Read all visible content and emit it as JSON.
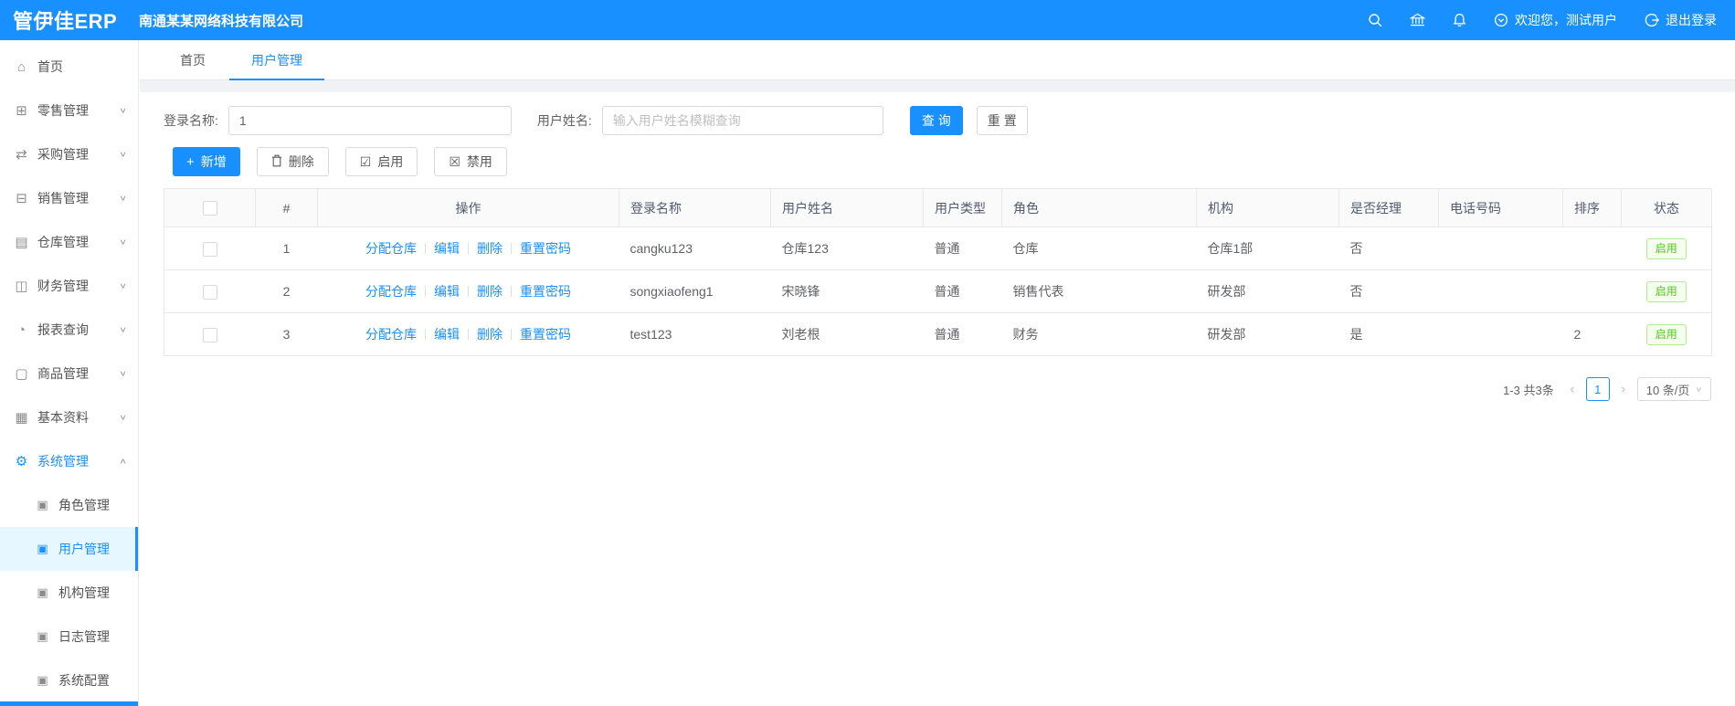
{
  "colors": {
    "primary": "#1890ff",
    "header_bg": "#1890ff",
    "success_text": "#52c41a",
    "success_border": "#b7eb8f",
    "success_bg": "#f6ffed",
    "selected_item_bg": "#e6f7ff"
  },
  "header": {
    "logo": "管伊佳ERP",
    "company": "南通某某网络科技有限公司",
    "welcome": "欢迎您，测试用户",
    "logout": "退出登录"
  },
  "sidebar": {
    "items": [
      {
        "label": "首页",
        "glyph": "⌂",
        "chevron": ""
      },
      {
        "label": "零售管理",
        "glyph": "⊞",
        "chevron": "∨"
      },
      {
        "label": "采购管理",
        "glyph": "⇄",
        "chevron": "∨"
      },
      {
        "label": "销售管理",
        "glyph": "⊟",
        "chevron": "∨"
      },
      {
        "label": "仓库管理",
        "glyph": "▤",
        "chevron": "∨"
      },
      {
        "label": "财务管理",
        "glyph": "◫",
        "chevron": "∨"
      },
      {
        "label": "报表查询",
        "glyph": "◔",
        "chevron": "∨"
      },
      {
        "label": "商品管理",
        "glyph": "▢",
        "chevron": "∨"
      },
      {
        "label": "基本资料",
        "glyph": "▦",
        "chevron": "∨"
      },
      {
        "label": "系统管理",
        "glyph": "⚙",
        "chevron": "∧"
      }
    ],
    "subitems": [
      {
        "label": "角色管理",
        "glyph": "▣"
      },
      {
        "label": "用户管理",
        "glyph": "▣"
      },
      {
        "label": "机构管理",
        "glyph": "▣"
      },
      {
        "label": "日志管理",
        "glyph": "▣"
      },
      {
        "label": "系统配置",
        "glyph": "▣"
      }
    ]
  },
  "tabs": [
    {
      "label": "首页"
    },
    {
      "label": "用户管理"
    }
  ],
  "filters": {
    "login_label": "登录名称:",
    "login_value": "1",
    "name_label": "用户姓名:",
    "name_placeholder": "输入用户姓名模糊查询",
    "search": "查 询",
    "reset": "重置"
  },
  "toolbar": {
    "add": "新增",
    "add_glyph": "+",
    "delete": "删除",
    "enable": "启用",
    "enable_glyph": "☑",
    "disable": "禁用",
    "disable_glyph": "☒"
  },
  "table": {
    "columns": [
      "#",
      "操作",
      "登录名称",
      "用户姓名",
      "用户类型",
      "角色",
      "机构",
      "是否经理",
      "电话号码",
      "排序",
      "状态"
    ],
    "action_links": [
      "分配仓库",
      "编辑",
      "删除",
      "重置密码"
    ],
    "rows": [
      {
        "index": "1",
        "login": "cangku123",
        "name": "仓库123",
        "type": "普通",
        "role": "仓库",
        "org": "仓库1部",
        "manager": "否",
        "phone": "",
        "sort": "",
        "status": "启用"
      },
      {
        "index": "2",
        "login": "songxiaofeng1",
        "name": "宋晓锋",
        "type": "普通",
        "role": "销售代表",
        "org": "研发部",
        "manager": "否",
        "phone": "",
        "sort": "",
        "status": "启用"
      },
      {
        "index": "3",
        "login": "test123",
        "name": "刘老根",
        "type": "普通",
        "role": "财务",
        "org": "研发部",
        "manager": "是",
        "phone": "",
        "sort": "2",
        "status": "启用"
      }
    ]
  },
  "pagination": {
    "total": "1-3 共3条",
    "prev": "‹",
    "page": "1",
    "next": "›",
    "page_size": "10 条/页",
    "caret": "∨"
  }
}
